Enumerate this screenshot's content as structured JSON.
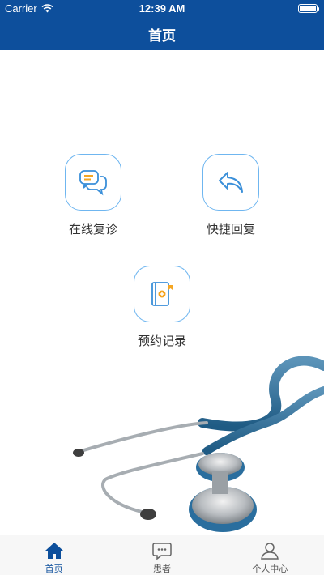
{
  "status_bar": {
    "carrier": "Carrier",
    "time": "12:39 AM"
  },
  "nav": {
    "title": "首页"
  },
  "menu": {
    "online_followup": {
      "label": "在线复诊",
      "icon": "chat-bubbles-icon"
    },
    "quick_reply": {
      "label": "快捷回复",
      "icon": "reply-arrow-icon"
    },
    "appointment_records": {
      "label": "预约记录",
      "icon": "medical-book-icon"
    }
  },
  "tabbar": {
    "items": [
      {
        "label": "首页",
        "icon": "home-icon",
        "active": true
      },
      {
        "label": "患者",
        "icon": "message-icon",
        "active": false
      },
      {
        "label": "个人中心",
        "icon": "person-icon",
        "active": false
      }
    ]
  },
  "colors": {
    "brand": "#0d4f9c",
    "tile_border": "#6fb6f0",
    "icon_orange": "#f5a623",
    "icon_blue": "#3a8fd9"
  }
}
